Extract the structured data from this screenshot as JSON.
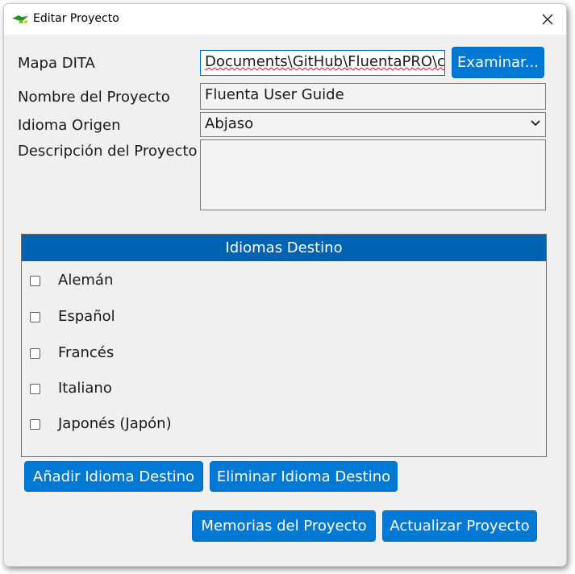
{
  "window": {
    "title": "Editar Proyecto"
  },
  "form": {
    "dita_map_label": "Mapa DITA",
    "dita_map_value": "Documents\\GitHub\\FluentaPRO\\c",
    "browse_button": "Examinar...",
    "project_name_label": "Nombre del Proyecto",
    "project_name_value": "Fluenta User Guide",
    "source_language_label": "Idioma Origen",
    "source_language_value": "Abjaso",
    "description_label": "Descripción del Proyecto",
    "description_value": ""
  },
  "target_languages": {
    "header": "Idiomas Destino",
    "items": [
      {
        "label": "Alemán",
        "checked": false
      },
      {
        "label": "Español",
        "checked": false
      },
      {
        "label": "Francés",
        "checked": false
      },
      {
        "label": "Italiano",
        "checked": false
      },
      {
        "label": "Japonés (Japón)",
        "checked": false
      }
    ]
  },
  "buttons": {
    "add_target_language": "Añadir Idioma Destino",
    "remove_target_language": "Eliminar Idioma Destino",
    "project_memories": "Memorias del Proyecto",
    "update_project": "Actualizar Proyecto"
  },
  "colors": {
    "accent": "#0078d4",
    "group_header": "#0063b1",
    "window_bg": "#f0f0f0"
  },
  "icons": {
    "app": "fluenta-app-icon",
    "close": "close-icon",
    "select": "chevron-down-icon"
  }
}
